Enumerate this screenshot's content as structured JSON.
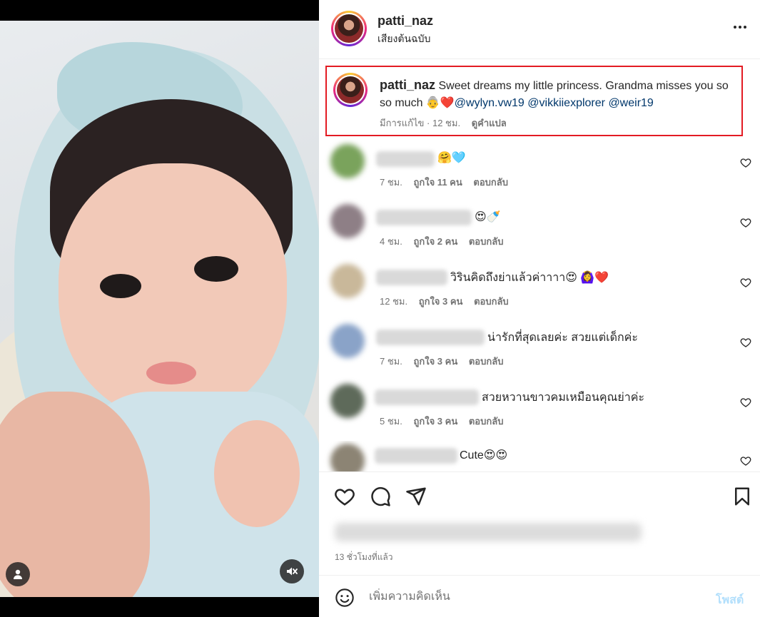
{
  "post": {
    "username": "patti_naz",
    "audio_label": "เสียงต้นฉบับ",
    "more_label": "•••"
  },
  "caption": {
    "username": "patti_naz",
    "text": "Sweet dreams my little princess. Grandma misses you so so much ",
    "emoji": "👵❤️",
    "mentions": [
      "@wylyn.vw19",
      "@vikkiiexplorer",
      "@weir19"
    ],
    "edited": "มีการแก้ไข",
    "time": "12 ชม.",
    "translate": "ดูคำแปล"
  },
  "comments": [
    {
      "text": "🤗🩵",
      "time": "7 ชม.",
      "likes": "ถูกใจ 11 คน",
      "reply": "ตอบกลับ"
    },
    {
      "text": "😍🍼",
      "time": "4 ชม.",
      "likes": "ถูกใจ 2 คน",
      "reply": "ตอบกลับ"
    },
    {
      "text": "วิรินคิดถึงย่าแล้วค่าาาา😍 🙆‍♀️❤️",
      "time": "12 ชม.",
      "likes": "ถูกใจ 3 คน",
      "reply": "ตอบกลับ"
    },
    {
      "text": "น่ารักที่สุดเลยค่ะ สวยแต่เด็กค่ะ",
      "time": "7 ชม.",
      "likes": "ถูกใจ 3 คน",
      "reply": "ตอบกลับ"
    },
    {
      "text": "สวยหวานขาวคมเหมือนคุณย่าค่ะ",
      "time": "5 ชม.",
      "likes": "ถูกใจ 3 คน",
      "reply": "ตอบกลับ"
    },
    {
      "text": "Cute😍😍",
      "time": "",
      "likes": "",
      "reply": ""
    }
  ],
  "footer": {
    "time_ago": "13 ชั่วโมงที่แล้ว",
    "comment_placeholder": "เพิ่มความคิดเห็น",
    "post_label": "โพสต์"
  },
  "icons": {
    "like": "heart-icon",
    "comment": "comment-icon",
    "share": "share-icon",
    "save": "bookmark-icon",
    "emoji": "emoji-icon",
    "user_tag": "user-icon",
    "mute": "mute-icon"
  },
  "colors": {
    "highlight_border": "#e31b23",
    "mention": "#00376b",
    "post_button_disabled": "#b2dffc"
  }
}
